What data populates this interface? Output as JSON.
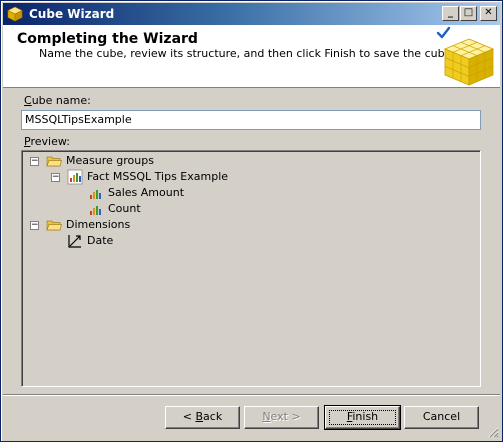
{
  "window": {
    "title": "Cube Wizard",
    "app_icon": "cube-icon"
  },
  "title_buttons": {
    "minimize": "_",
    "maximize": "□",
    "close": "✕"
  },
  "header": {
    "title": "Completing the Wizard",
    "subtitle": "Name the cube, review its structure, and then click Finish to save the cube.",
    "art": "gold-cube-checkmark-icon"
  },
  "cube_name": {
    "label_first": "C",
    "label_rest": "ube name:",
    "value": "MSSQLTipsExample"
  },
  "preview": {
    "label_first": "P",
    "label_rest": "review:",
    "tree": {
      "measure_groups": "Measure groups",
      "fact_table": "Fact MSSQL Tips Example",
      "measure_sales": "Sales Amount",
      "measure_count": "Count",
      "dimensions": "Dimensions",
      "dimension_date": "Date"
    }
  },
  "buttons": {
    "back_prefix": "< ",
    "back_u": "B",
    "back_rest": "ack",
    "next_u": "N",
    "next_rest": "ext >",
    "finish_u": "F",
    "finish_rest": "inish",
    "cancel": "Cancel"
  },
  "colors": {
    "title_bar": "#0a246a",
    "folder": "#f0c040",
    "cube": "#e8c020"
  }
}
